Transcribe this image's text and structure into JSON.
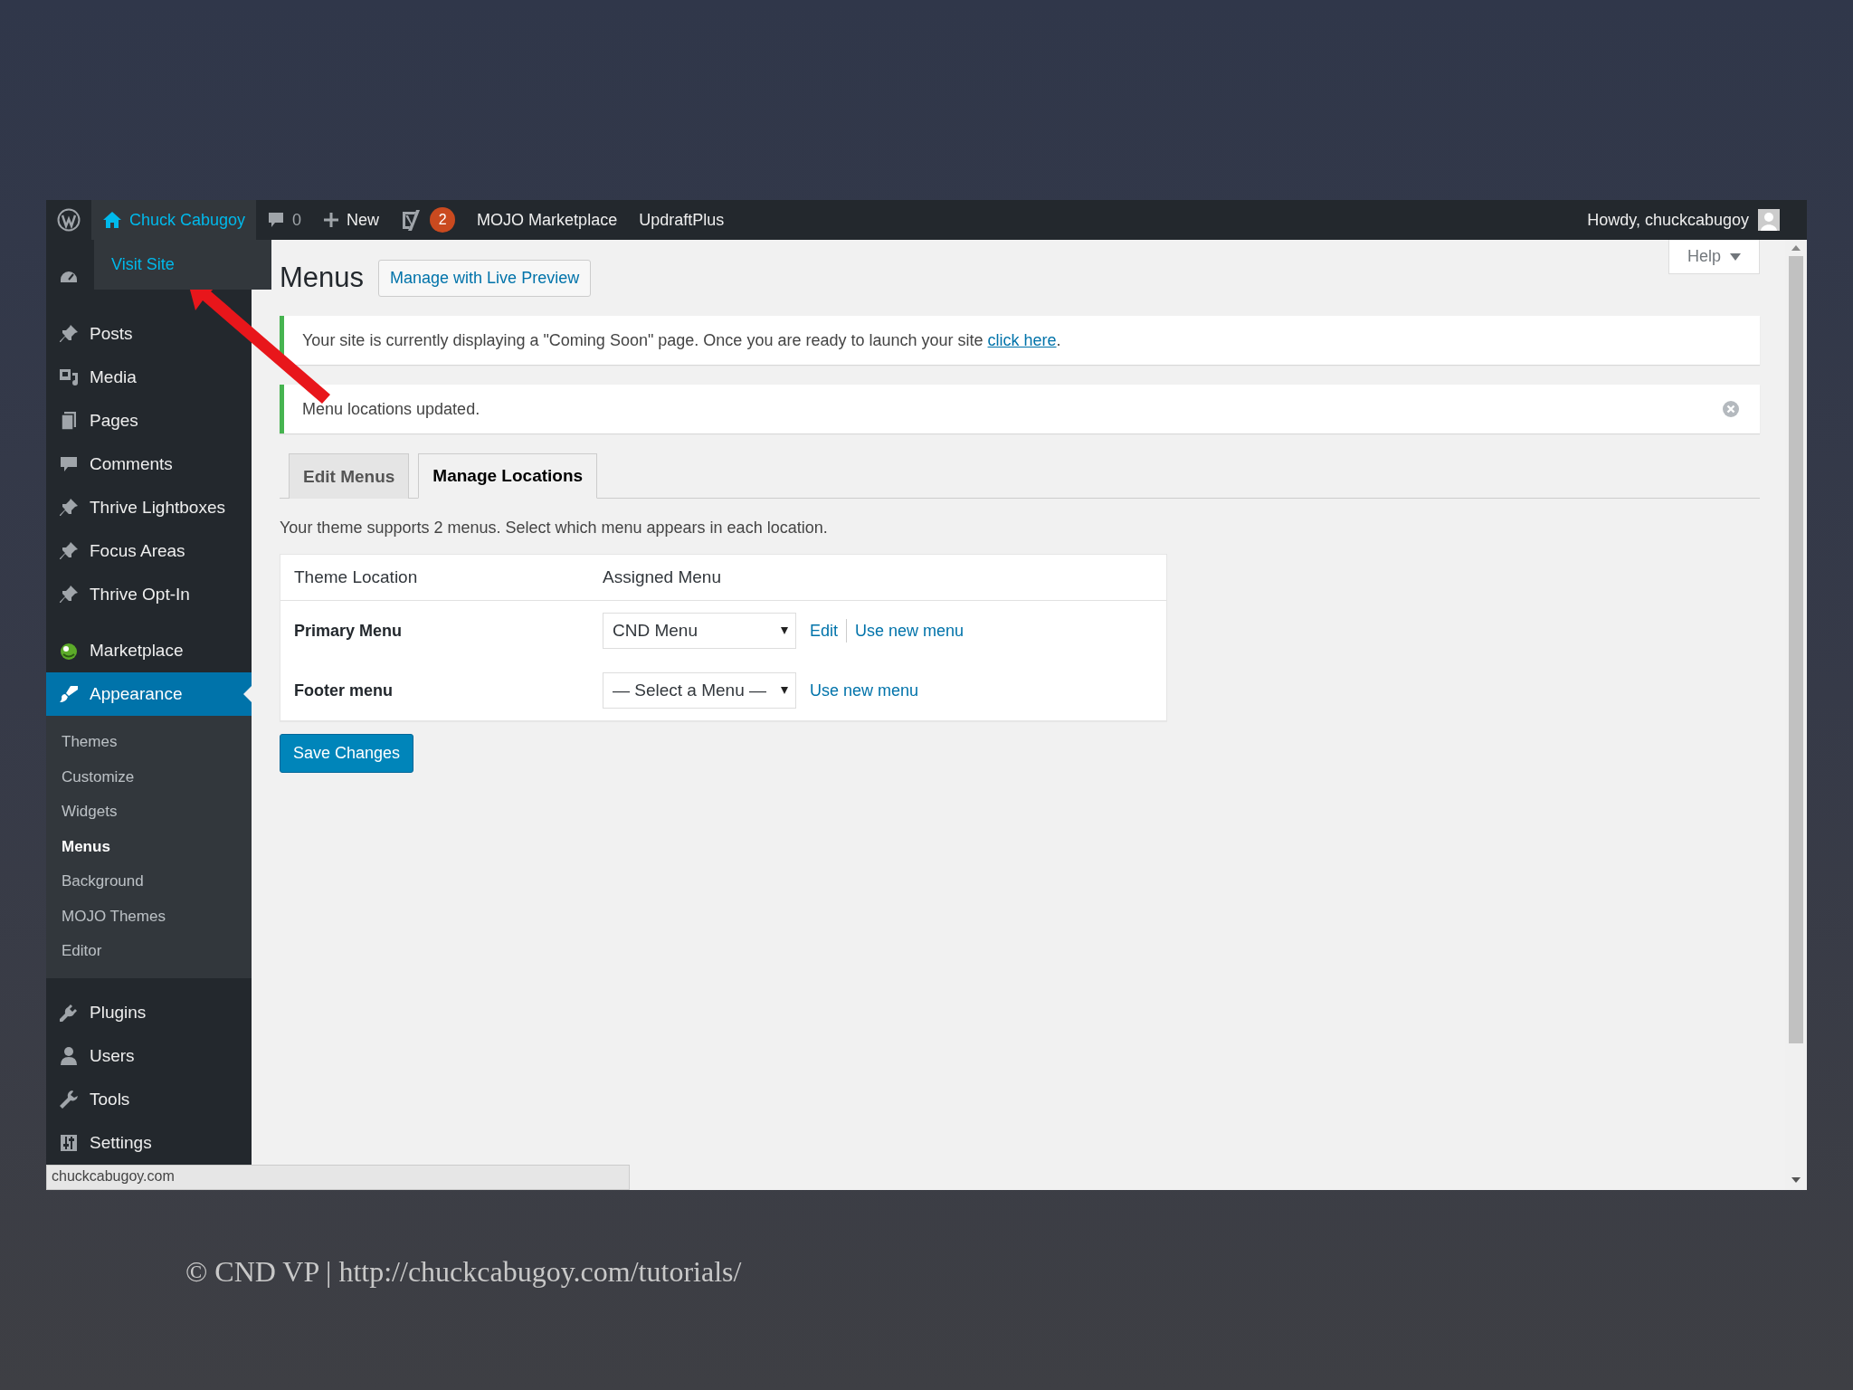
{
  "admin_bar": {
    "items": [
      {
        "kind": "logo"
      },
      {
        "kind": "site",
        "label": "Chuck Cabugoy",
        "expanded": true
      },
      {
        "kind": "comments",
        "label": "0"
      },
      {
        "kind": "new",
        "label": "New"
      },
      {
        "kind": "seo",
        "badge": "2"
      },
      {
        "kind": "text",
        "label": "MOJO Marketplace"
      },
      {
        "kind": "text",
        "label": "UpdraftPlus"
      }
    ],
    "account": "Howdy, chuckcabugoy"
  },
  "site_dropdown": {
    "items": [
      "Visit Site"
    ]
  },
  "sidebar": {
    "sections": [
      {
        "items": [
          {
            "kind": "dashboard",
            "selected": false
          }
        ]
      },
      {
        "items": [
          {
            "kind": "post",
            "label": "Posts",
            "selected": false
          },
          {
            "kind": "media",
            "label": "Media",
            "selected": false
          },
          {
            "kind": "page",
            "label": "Pages",
            "selected": false
          },
          {
            "kind": "comment",
            "label": "Comments",
            "selected": false
          },
          {
            "kind": "post",
            "label": "Thrive Lightboxes",
            "selected": false
          },
          {
            "kind": "post",
            "label": "Focus Areas",
            "selected": false
          },
          {
            "kind": "post",
            "label": "Thrive Opt-In",
            "selected": false
          }
        ]
      },
      {
        "items": [
          {
            "kind": "marketplace",
            "label": "Marketplace",
            "selected": false
          },
          {
            "kind": "appearance",
            "label": "Appearance",
            "selected": true,
            "children": [
              {
                "label": "Themes",
                "selected": false
              },
              {
                "label": "Customize",
                "selected": false
              },
              {
                "label": "Widgets",
                "selected": false
              },
              {
                "label": "Menus",
                "selected": true
              },
              {
                "label": "Background",
                "selected": false
              },
              {
                "label": "MOJO Themes",
                "selected": false
              },
              {
                "label": "Editor",
                "selected": false
              }
            ]
          }
        ]
      },
      {
        "items": [
          {
            "kind": "plugin",
            "label": "Plugins",
            "selected": false
          },
          {
            "kind": "user",
            "label": "Users",
            "selected": false
          },
          {
            "kind": "tool",
            "label": "Tools",
            "selected": false
          },
          {
            "kind": "settings",
            "label": "Settings",
            "selected": false
          }
        ]
      }
    ]
  },
  "page": {
    "title": "Menus",
    "action": "Manage with Live Preview",
    "help": "Help"
  },
  "notices": [
    {
      "text": "Your site is currently displaying a \"Coming Soon\" page. Once you are ready to launch your site ",
      "link": "click here",
      "after": ".",
      "dismissible": false
    },
    {
      "text": "Menu locations updated.",
      "dismissible": true
    }
  ],
  "tabs": [
    {
      "label": "Edit Menus",
      "selected": false
    },
    {
      "label": "Manage Locations",
      "selected": true
    }
  ],
  "description": "Your theme supports 2 menus. Select which menu appears in each location.",
  "table": {
    "columns": [
      "Theme Location",
      "Assigned Menu"
    ],
    "rows": [
      {
        "location": "Primary Menu",
        "menu": "CND Menu",
        "actions": [
          "Edit",
          "Use new menu"
        ]
      },
      {
        "location": "Footer menu",
        "menu": "— Select a Menu —",
        "actions": [
          "Use new menu"
        ]
      }
    ]
  },
  "save_button": "Save Changes",
  "status_url": "chuckcabugoy.com",
  "caption": "© CND VP | http://chuckcabugoy.com/tutorials/"
}
